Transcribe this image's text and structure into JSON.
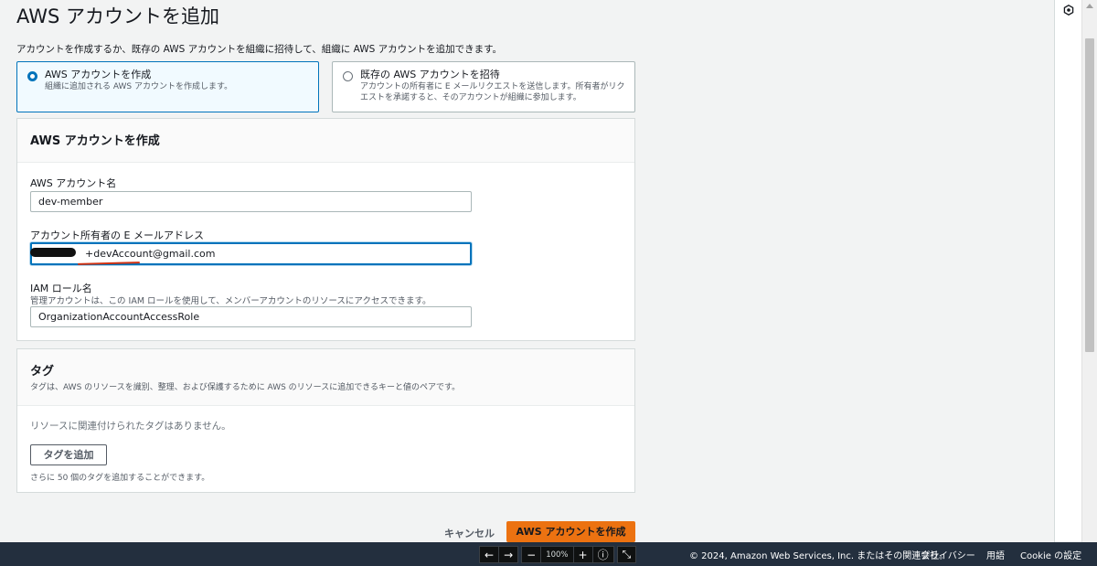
{
  "page": {
    "title": "AWS アカウントを追加",
    "description": "アカウントを作成するか、既存の AWS アカウントを組織に招待して、組織に AWS アカウントを追加できます。"
  },
  "options": [
    {
      "title": "AWS アカウントを作成",
      "desc": "組織に追加される AWS アカウントを作成します。",
      "selected": true
    },
    {
      "title": "既存の AWS アカウントを招待",
      "desc": "アカウントの所有者に E メールリクエストを送信します。所有者がリクエストを承諾すると、そのアカウントが組織に参加します。",
      "selected": false
    }
  ],
  "create_panel": {
    "title": "AWS アカウントを作成",
    "account_name_label": "AWS アカウント名",
    "account_name_value": "dev-member",
    "email_label": "アカウント所有者の E メールアドレス",
    "email_value": "+devAccount@gmail.com",
    "iam_label": "IAM ロール名",
    "iam_desc": "管理アカウントは、この IAM ロールを使用して、メンバーアカウントのリソースにアクセスできます。",
    "iam_value": "OrganizationAccountAccessRole"
  },
  "tags_panel": {
    "title": "タグ",
    "desc": "タグは、AWS のリソースを識別、整理、および保護するために AWS のリソースに追加できるキーと値のペアです。",
    "empty_text": "リソースに関連付けられたタグはありません。",
    "add_button": "タグを追加",
    "limit_text": "さらに 50 個のタグを追加することができます。"
  },
  "actions": {
    "cancel": "キャンセル",
    "submit": "AWS アカウントを作成"
  },
  "zoom": {
    "back": "←",
    "forward": "→",
    "minus": "−",
    "level": "100%",
    "plus": "+",
    "info": "ⓘ",
    "collapse": "⤡"
  },
  "footer": {
    "copyright": "© 2024, Amazon Web Services, Inc. またはその関連会社。",
    "privacy": "プライバシー",
    "terms": "用語",
    "cookie": "Cookie の設定"
  },
  "colors": {
    "primary": "#ec7211",
    "selected_border": "#0073bb",
    "footer_bg": "#232f3e"
  }
}
